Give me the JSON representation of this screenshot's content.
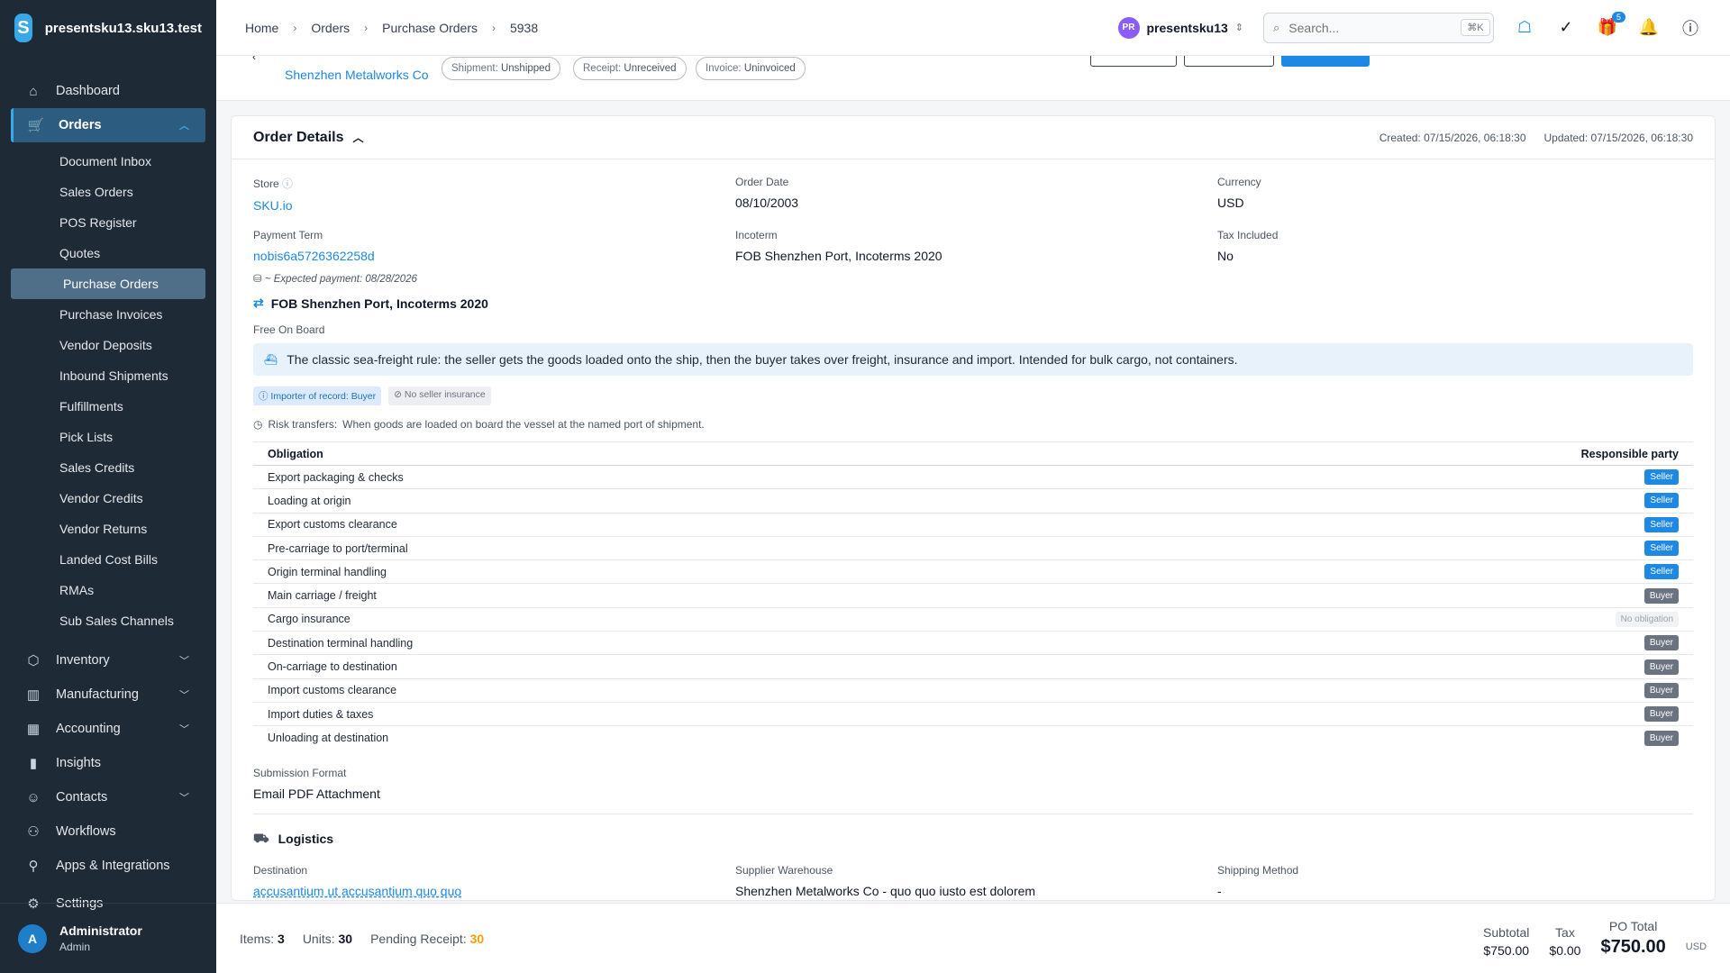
{
  "app": {
    "workspace": "presentsku13.sku13.test",
    "logo_letter": "S"
  },
  "sidebar": {
    "items": [
      {
        "label": "Dashboard",
        "icon": "home-icon"
      },
      {
        "label": "Orders",
        "icon": "cart-icon"
      }
    ],
    "orders_sub": [
      "Document Inbox",
      "Sales Orders",
      "POS Register",
      "Quotes",
      "Purchase Orders",
      "Purchase Invoices",
      "Vendor Deposits",
      "Inbound Shipments",
      "Fulfillments",
      "Pick Lists",
      "Sales Credits",
      "Vendor Credits",
      "Vendor Returns",
      "Landed Cost Bills",
      "RMAs",
      "Sub Sales Channels"
    ],
    "lower_items": [
      "Inventory",
      "Manufacturing",
      "Accounting",
      "Insights",
      "Contacts",
      "Workflows",
      "Apps & Integrations",
      "Settings"
    ],
    "user": {
      "initial": "A",
      "name": "Administrator",
      "role": "Admin"
    }
  },
  "topbar": {
    "breadcrumbs": [
      "Home",
      "Orders",
      "Purchase Orders",
      "5938"
    ],
    "account_initials": "PR",
    "account_name": "presentsku13",
    "search_placeholder": "Search...",
    "search_shortcut": "⌘K",
    "gift_badge": "5"
  },
  "header": {
    "vendor": "Shenzhen Metalworks Co",
    "chips": [
      {
        "k": "Shipment:",
        "v": "Unshipped"
      },
      {
        "k": "Receipt:",
        "v": "Unreceived"
      },
      {
        "k": "Invoice:",
        "v": "Uninvoiced"
      }
    ]
  },
  "order": {
    "title": "Order Details",
    "created": "Created: 07/15/2026, 06:18:30",
    "updated": "Updated: 07/15/2026, 06:18:30",
    "fields": {
      "store_label": "Store",
      "store": "SKU.io",
      "order_date_label": "Order Date",
      "order_date": "08/10/2003",
      "currency_label": "Currency",
      "currency": "USD",
      "payment_term_label": "Payment Term",
      "payment_term": "nobis6a5726362258d",
      "incoterm_label": "Incoterm",
      "incoterm": "FOB Shenzhen Port, Incoterms 2020",
      "tax_label": "Tax Included",
      "tax": "No"
    },
    "expected_payment": "~ Expected payment: 08/28/2026",
    "incoterm_title": "FOB Shenzhen Port, Incoterms 2020",
    "incoterm_subtitle": "Free On Board",
    "incoterm_desc": "The classic sea-freight rule: the seller gets the goods loaded onto the ship, then the buyer takes over freight, insurance and import. Intended for bulk cargo, not containers.",
    "tags": [
      "Importer of record: Buyer",
      "No seller insurance"
    ],
    "risk_label": "Risk transfers:",
    "risk_text": "When goods are loaded on board the vessel at the named port of shipment.",
    "obligations_head": {
      "left": "Obligation",
      "right": "Responsible party"
    },
    "obligations": [
      {
        "name": "Export packaging & checks",
        "party": "Seller",
        "kind": "seller"
      },
      {
        "name": "Loading at origin",
        "party": "Seller",
        "kind": "seller"
      },
      {
        "name": "Export customs clearance",
        "party": "Seller",
        "kind": "seller"
      },
      {
        "name": "Pre-carriage to port/terminal",
        "party": "Seller",
        "kind": "seller"
      },
      {
        "name": "Origin terminal handling",
        "party": "Seller",
        "kind": "seller"
      },
      {
        "name": "Main carriage / freight",
        "party": "Buyer",
        "kind": "buyer"
      },
      {
        "name": "Cargo insurance",
        "party": "No obligation",
        "kind": "none"
      },
      {
        "name": "Destination terminal handling",
        "party": "Buyer",
        "kind": "buyer"
      },
      {
        "name": "On-carriage to destination",
        "party": "Buyer",
        "kind": "buyer"
      },
      {
        "name": "Import customs clearance",
        "party": "Buyer",
        "kind": "buyer"
      },
      {
        "name": "Import duties & taxes",
        "party": "Buyer",
        "kind": "buyer"
      },
      {
        "name": "Unloading at destination",
        "party": "Buyer",
        "kind": "buyer"
      }
    ],
    "submission_label": "Submission Format",
    "submission": "Email PDF Attachment"
  },
  "logistics": {
    "title": "Logistics",
    "destination_label": "Destination",
    "destination": "accusantium ut accusantium quo quo",
    "warehouse_label": "Supplier Warehouse",
    "warehouse": "Shenzhen Metalworks Co - quo quo iusto est dolorem",
    "method_label": "Shipping Method",
    "method": "-"
  },
  "footer": {
    "items_label": "Items:",
    "items": "3",
    "units_label": "Units:",
    "units": "30",
    "pending_label": "Pending Receipt:",
    "pending": "30",
    "subtotal_label": "Subtotal",
    "subtotal": "$750.00",
    "tax_label": "Tax",
    "tax": "$0.00",
    "total_label": "PO Total",
    "total": "$750.00",
    "currency": "USD"
  },
  "colors": {
    "accent": "#1e88e5",
    "sidebar": "#1f2a37",
    "buyer": "#6b7280"
  }
}
